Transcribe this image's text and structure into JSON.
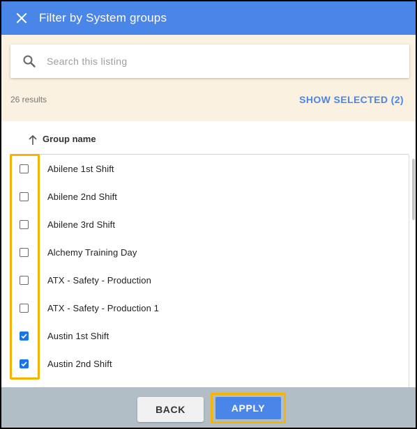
{
  "header": {
    "title": "Filter by System groups",
    "close_icon": "close-icon"
  },
  "search": {
    "placeholder": "Search this listing",
    "value": "",
    "icon": "search-icon"
  },
  "results_count": "26 results",
  "show_selected_label": "SHOW SELECTED (2)",
  "column": {
    "label": "Group name",
    "sort_icon": "arrow-up-icon",
    "sort": "ascending"
  },
  "rows": [
    {
      "label": "Abilene 1st Shift",
      "checked": false
    },
    {
      "label": "Abilene 2nd Shift",
      "checked": false
    },
    {
      "label": "Abilene 3rd Shift",
      "checked": false
    },
    {
      "label": "Alchemy Training Day",
      "checked": false
    },
    {
      "label": "ATX - Safety - Production",
      "checked": false
    },
    {
      "label": "ATX - Safety - Production 1",
      "checked": false
    },
    {
      "label": "Austin 1st Shift",
      "checked": true
    },
    {
      "label": "Austin 2nd Shift",
      "checked": true
    }
  ],
  "footer": {
    "back_label": "BACK",
    "apply_label": "APPLY"
  },
  "colors": {
    "header": "#4a86e8",
    "filter_bg": "#fbf1e0",
    "accent": "#4a86e8",
    "highlight": "#f4b400",
    "footer_bg": "#b2bec6",
    "checkbox_checked": "#1a73e8"
  }
}
